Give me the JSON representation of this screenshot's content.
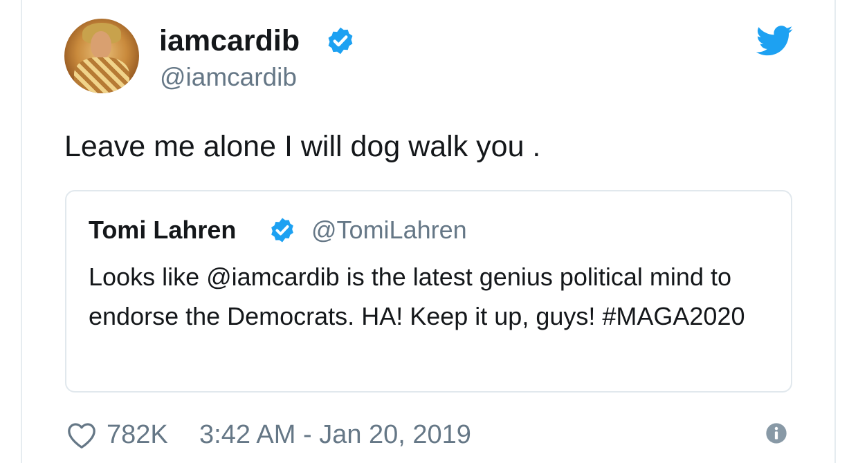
{
  "tweet": {
    "author_name": "iamcardib",
    "author_handle": "@iamcardib",
    "text": "Leave me alone I will dog walk you .",
    "likes": "782K",
    "timestamp": "3:42 AM - Jan 20, 2019"
  },
  "quoted_tweet": {
    "author_name": "Tomi Lahren",
    "author_handle": "@TomiLahren",
    "text": "Looks like @iamcardib is the latest genius political mind to endorse the Democrats. HA! Keep it up, guys! #MAGA2020"
  },
  "icons": {
    "verified": "verified-badge-icon",
    "brand": "twitter-bird-icon",
    "like": "heart-icon",
    "info": "info-icon"
  },
  "colors": {
    "twitter_blue": "#1da1f2",
    "text_primary": "#14171a",
    "text_secondary": "#657786",
    "border": "#e1e8ed"
  }
}
